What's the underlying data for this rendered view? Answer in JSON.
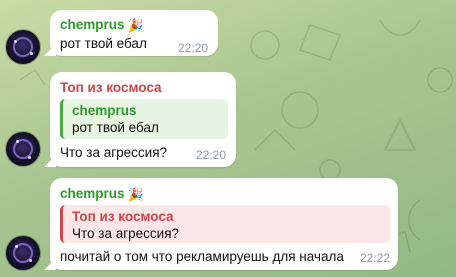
{
  "messages": [
    {
      "sender": "chemprus",
      "sender_badge": "🎉",
      "text": "рот твой ебал",
      "time": "22:20"
    },
    {
      "sender": "Топ из космоса",
      "reply_to": {
        "sender": "chemprus",
        "text": "рот твой ебал"
      },
      "text": "Что за агрессия?",
      "time": "22:20"
    },
    {
      "sender": "chemprus",
      "sender_badge": "🎉",
      "reply_to": {
        "sender": "Топ из космоса",
        "text": "Что за агрессия?"
      },
      "text": "почитай о том что рекламируешь для начала",
      "time": "22:22"
    }
  ],
  "colors": {
    "sender_green": "#2f9a2c",
    "sender_red": "#d3434b",
    "bubble": "#ffffff",
    "time": "#8e9aa4"
  },
  "icons": [
    "avatar",
    "party-badge-icon"
  ]
}
